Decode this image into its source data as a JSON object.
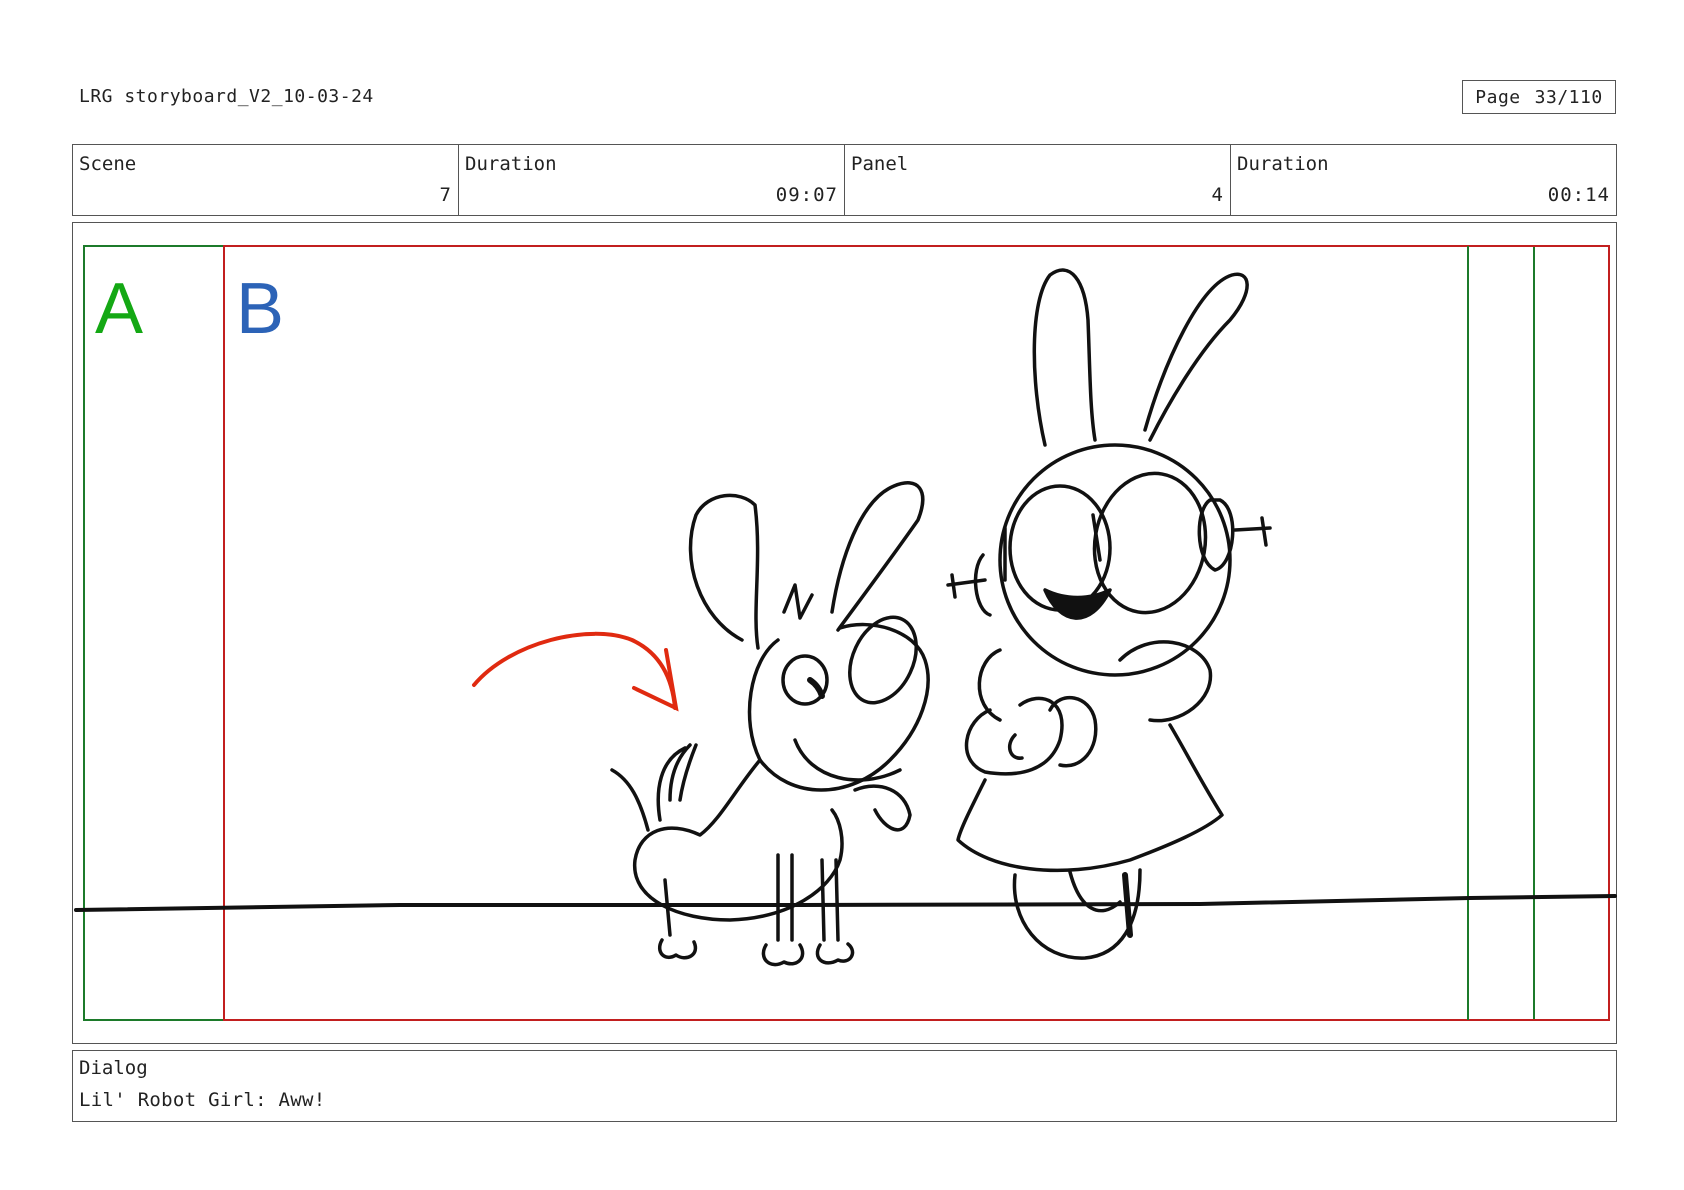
{
  "header": {
    "document_title": "LRG storyboard_V2_10-03-24",
    "page_label": "Page",
    "page_value": "33/110"
  },
  "info": {
    "scene_label": "Scene",
    "scene_value": "7",
    "scene_duration_label": "Duration",
    "scene_duration_value": "09:07",
    "panel_label": "Panel",
    "panel_value": "4",
    "panel_duration_label": "Duration",
    "panel_duration_value": "00:14"
  },
  "frame": {
    "safe_area_label_a": "A",
    "safe_area_label_b": "B",
    "colors": {
      "frame_a": "#1c7a2a",
      "frame_b": "#c21f1f",
      "label_a": "#14a814",
      "label_b": "#2c63b7",
      "motion_arrow": "#e02a10"
    }
  },
  "dialog": {
    "label": "Dialog",
    "text": "Lil' Robot Girl: Aww!"
  }
}
